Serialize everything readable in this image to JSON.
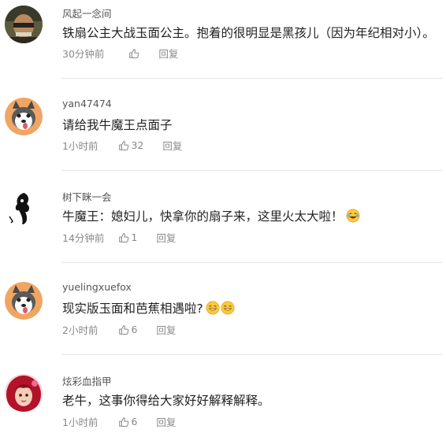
{
  "comments": [
    {
      "username": "风起一念间",
      "text": "铁扇公主大战玉面公主。抱着的很明显是黑孩儿（因为年纪相对小）。",
      "time": "30分钟前",
      "likes": "",
      "reply": "回复",
      "avatar": "photo-avatar-icon"
    },
    {
      "username": "yan47474",
      "text": "请给我牛魔王点面子",
      "time": "1小时前",
      "likes": "32",
      "reply": "回复",
      "avatar": "husky-avatar-icon"
    },
    {
      "username": "树下眯一会",
      "text": "牛魔王：媳妇儿，快拿你的扇子来，这里火太大啦！",
      "time": "14分钟前",
      "likes": "1",
      "reply": "回复",
      "avatar": "ink-figure-avatar-icon"
    },
    {
      "username": "yuelingxuefox",
      "text": "现实版玉面和芭蕉相遇啦?",
      "time": "2小时前",
      "likes": "6",
      "reply": "回复",
      "avatar": "husky-avatar-icon"
    },
    {
      "username": "炫彩血指甲",
      "text": "老牛，这事你得给大家好好解释解释。",
      "time": "1小时前",
      "likes": "6",
      "reply": "回复",
      "avatar": "red-hair-girl-avatar-icon"
    }
  ],
  "colors": {
    "username": "#555555",
    "meta": "#888888",
    "text": "#222222",
    "divider": "#e6e6e6"
  }
}
